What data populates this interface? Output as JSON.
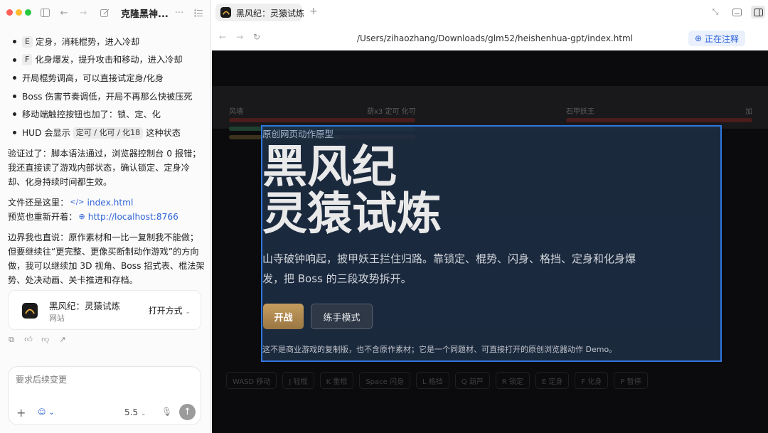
{
  "sidebar": {
    "chat_title": "克隆黑神...",
    "bullets": [
      {
        "key": "E",
        "text": "定身，消耗棍势，进入冷却"
      },
      {
        "key": "F",
        "text": "化身爆发，提升攻击和移动，进入冷却"
      },
      {
        "key": "",
        "text": "开局棍势调高，可以直接试定身/化身"
      },
      {
        "key": "",
        "text": "Boss 伤害节奏调低，开局不再那么快被压死"
      },
      {
        "key": "",
        "text": "移动端触控按钮也加了：锁、定、化"
      },
      {
        "key": "",
        "text": "HUD 会显示",
        "code": "定可 / 化可 / 化18",
        "suffix": "这种状态"
      }
    ],
    "verify": "验证过了：脚本语法通过，浏览器控制台 0 报错；我还直接读了游戏内部状态，确认锁定、定身冷却、化身持续时间都生效。",
    "file_label": "文件还是这里：",
    "file_link": "index.html",
    "preview_label": "预览也重新开着：",
    "preview_link": "http://localhost:8766",
    "boundary": "边界我也直说：原作素材和一比一复制我不能做；但要继续往“更完整、更像买断制动作游戏”的方向做，我可以继续加 3D 视角、Boss 招式表、棍法架势、处决动画、关卡推进和存档。",
    "card": {
      "title": "黑风纪：灵猿试炼",
      "subtitle": "网站",
      "open_label": "打开方式"
    },
    "composer": {
      "placeholder": "要求后续变更",
      "model": "5.5"
    }
  },
  "browser": {
    "tab_title": "黑风纪：灵猿试炼",
    "url": "/Users/zihaozhang/Downloads/glm52/heishenhua-gpt/index.html",
    "annotate_label": "正在注释"
  },
  "game": {
    "hud": {
      "left_label": "风墙",
      "mid_label": "葫x3 定可 化可",
      "right_label": "石甲妖王",
      "right_value": "加",
      "bars": {
        "player_hp": 1.0,
        "player_stamina": 0.7,
        "player_focus": 0.6,
        "boss_hp": 1.0
      }
    },
    "overlay": {
      "eyebrow": "原创网页动作原型",
      "title_line1": "黑风纪",
      "title_line2": "灵猿试炼",
      "description": "山寺破钟响起，披甲妖王拦住归路。靠锁定、棍势、闪身、格挡、定身和化身爆发，把 Boss 的三段攻势拆开。",
      "start_label": "开战",
      "practice_label": "练手模式",
      "disclaimer": "这不是商业游戏的复制版，也不含原作素材；它是一个同题材、可直接打开的原创浏览器动作 Demo。"
    },
    "controls": [
      "WASD 移动",
      "J 轻棍",
      "K 重棍",
      "Space 闪身",
      "L 格挡",
      "Q 葫芦",
      "R 锁定",
      "E 定身",
      "F 化身",
      "P 暂停"
    ]
  },
  "colors": {
    "accent": "#2f64d6",
    "overlay_border": "#2f78e0",
    "start_button": "#b38b52",
    "hp_red": "#4a1a1a",
    "stamina_green": "#1f3a2a"
  }
}
